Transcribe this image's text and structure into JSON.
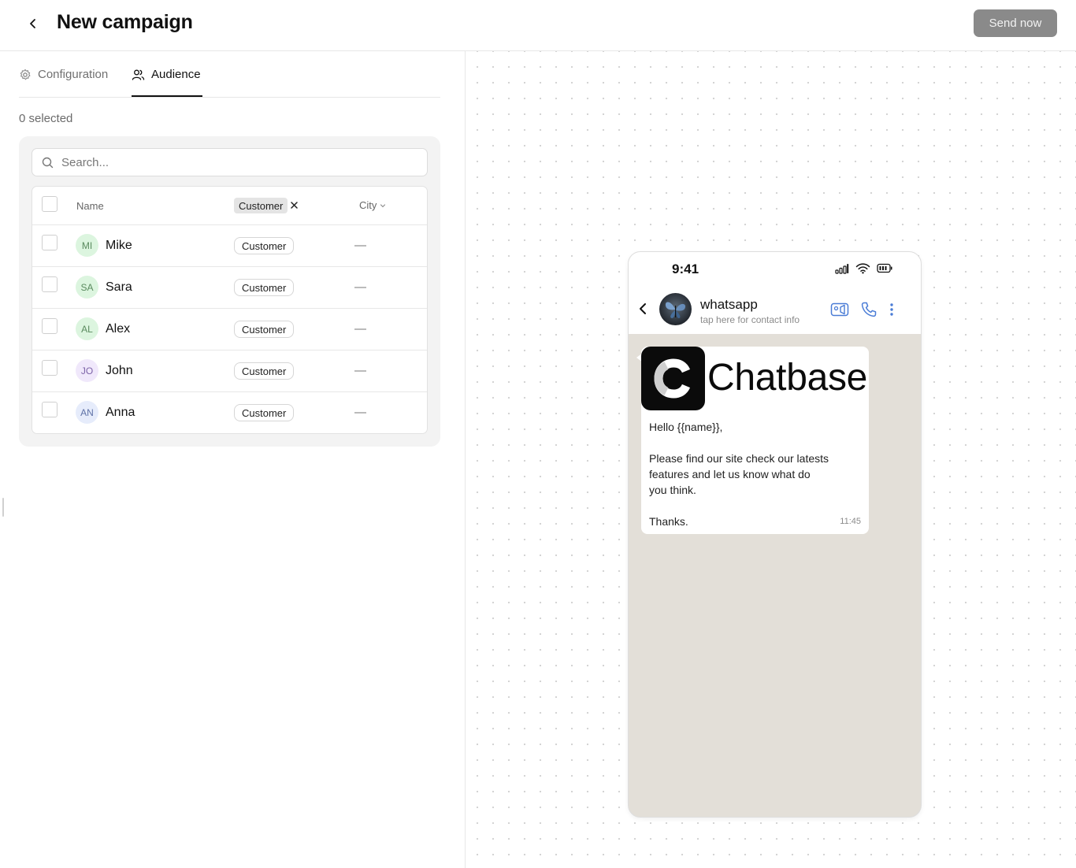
{
  "header": {
    "title": "New campaign",
    "send_label": "Send now",
    "back_icon": "chevron-left-icon"
  },
  "tabs": [
    {
      "label": "Configuration",
      "icon": "gear-icon",
      "active": false
    },
    {
      "label": "Audience",
      "icon": "users-icon",
      "active": true
    }
  ],
  "audience": {
    "selected_text": "0 selected",
    "search_placeholder": "Search...",
    "columns": {
      "name": "Name",
      "filter_chip": "Customer",
      "city": "City"
    },
    "rows": [
      {
        "initials": "MI",
        "name": "Mike",
        "tag": "Customer",
        "city": "—",
        "avatar_bg": "#dcf5df",
        "avatar_fg": "#5a8a5e"
      },
      {
        "initials": "SA",
        "name": "Sara",
        "tag": "Customer",
        "city": "—",
        "avatar_bg": "#dcf5df",
        "avatar_fg": "#5a8a5e"
      },
      {
        "initials": "AL",
        "name": "Alex",
        "tag": "Customer",
        "city": "—",
        "avatar_bg": "#dcf5df",
        "avatar_fg": "#5a8a5e"
      },
      {
        "initials": "JO",
        "name": "John",
        "tag": "Customer",
        "city": "—",
        "avatar_bg": "#f0e8fb",
        "avatar_fg": "#7d63a8"
      },
      {
        "initials": "AN",
        "name": "Anna",
        "tag": "Customer",
        "city": "—",
        "avatar_bg": "#e6ecfb",
        "avatar_fg": "#5f72a6"
      }
    ]
  },
  "preview": {
    "status_time": "9:41",
    "contact_name": "whatsapp",
    "contact_sub": "tap here for contact info",
    "brand_name": "Chatbase",
    "message": "Hello {{name}},\n\nPlease find our site check our latests features and let us know what do you think.\n\nThanks.",
    "message_time": "11:45",
    "chat_bg": "#e3dfd8"
  },
  "colors": {
    "send_button_bg": "#8a8a8a",
    "accent": "#111111",
    "call_icon": "#4a7cd6"
  }
}
